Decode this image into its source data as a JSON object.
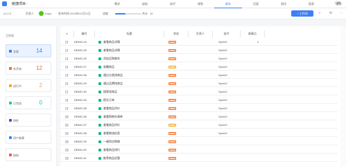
{
  "header": {
    "project": "敏捷项目",
    "tabs": [
      "需求",
      "缺陷",
      "迭代",
      "规划",
      "版本",
      "页面",
      "测试",
      "报表",
      "更多"
    ],
    "active_tab": "版本",
    "top_right": "设置"
  },
  "subbar": {
    "version": "v1.2.3",
    "owner_label": "负责人",
    "owner": "Kaya",
    "release_label": "发布时间",
    "release_date": "2019年12月31日",
    "progress_label": "进度",
    "progress": 40,
    "count_label": "共计",
    "count": "12",
    "new_button": "+ 工作项"
  },
  "left": {
    "title": "工作项",
    "items": [
      {
        "label": "全部",
        "count": "14",
        "color": "#3d7ff4"
      },
      {
        "label": "未开始",
        "count": "12",
        "color": "#f76b1c"
      },
      {
        "label": "进行中",
        "count": "2",
        "color": "#f5a623"
      },
      {
        "label": "已完成",
        "count": "0",
        "color": "#20c997"
      },
      {
        "label": "特性",
        "count": "",
        "color": "#6f42c1"
      },
      {
        "label": "用户故事",
        "count": "",
        "color": "#3d7ff4"
      },
      {
        "label": "缺陷",
        "count": "",
        "color": "#f55353"
      }
    ]
  },
  "table": {
    "headers": [
      "#",
      "编号",
      "标题",
      "状态",
      "负责人",
      "迭代",
      "故事点"
    ],
    "rows": [
      {
        "id": "DEMO-24",
        "title": "查看商品详情",
        "status": "未开始",
        "sprint": "Sprint2",
        "points": "2"
      },
      {
        "id": "DEMO-25",
        "title": "查看商品详情",
        "status": "未开始",
        "sprint": "Sprint2",
        "points": ""
      },
      {
        "id": "DEMO-26",
        "title": "添加至购物车",
        "status": "未开始",
        "sprint": "Sprint2",
        "points": ""
      },
      {
        "id": "DEMO-27",
        "title": "收藏商品",
        "status": "进行中",
        "sprint": "Sprint2",
        "points": ""
      },
      {
        "id": "DEMO-28",
        "title": "通过分类找商品",
        "status": "未开始",
        "sprint": "Sprint2",
        "points": ""
      },
      {
        "id": "DEMO-29",
        "title": "通过品牌找商品",
        "status": "未开始",
        "sprint": "Sprint2",
        "points": ""
      },
      {
        "id": "DEMO-30",
        "title": "搜索找商品",
        "status": "未开始",
        "sprint": "Sprint2",
        "points": ""
      },
      {
        "id": "DEMO-34",
        "title": "提交订单",
        "status": "未开始",
        "sprint": "Sprint2",
        "points": ""
      },
      {
        "id": "DEMO-35",
        "title": "查看商品评价",
        "status": "未开始",
        "sprint": "Sprint2",
        "points": ""
      },
      {
        "id": "DEMO-36",
        "title": "查看购物车清单",
        "status": "未开始",
        "sprint": "Sprint2",
        "points": ""
      },
      {
        "id": "DEMO-37",
        "title": "查看商品评价",
        "status": "进行中",
        "sprint": "Sprint2",
        "points": ""
      },
      {
        "id": "DEMO-38",
        "title": "查看物流信息",
        "status": "未开始",
        "sprint": "Sprint2",
        "points": ""
      },
      {
        "id": "DEMO-39",
        "title": "一键再次购物",
        "status": "未开始",
        "sprint": "",
        "points": ""
      },
      {
        "id": "DEMO-40",
        "title": "查看商品排行",
        "status": "未开始",
        "sprint": "",
        "points": ""
      },
      {
        "id": "DEMO-41",
        "title": "推荐商品优惠",
        "status": "未开始",
        "sprint": "",
        "points": ""
      }
    ]
  }
}
